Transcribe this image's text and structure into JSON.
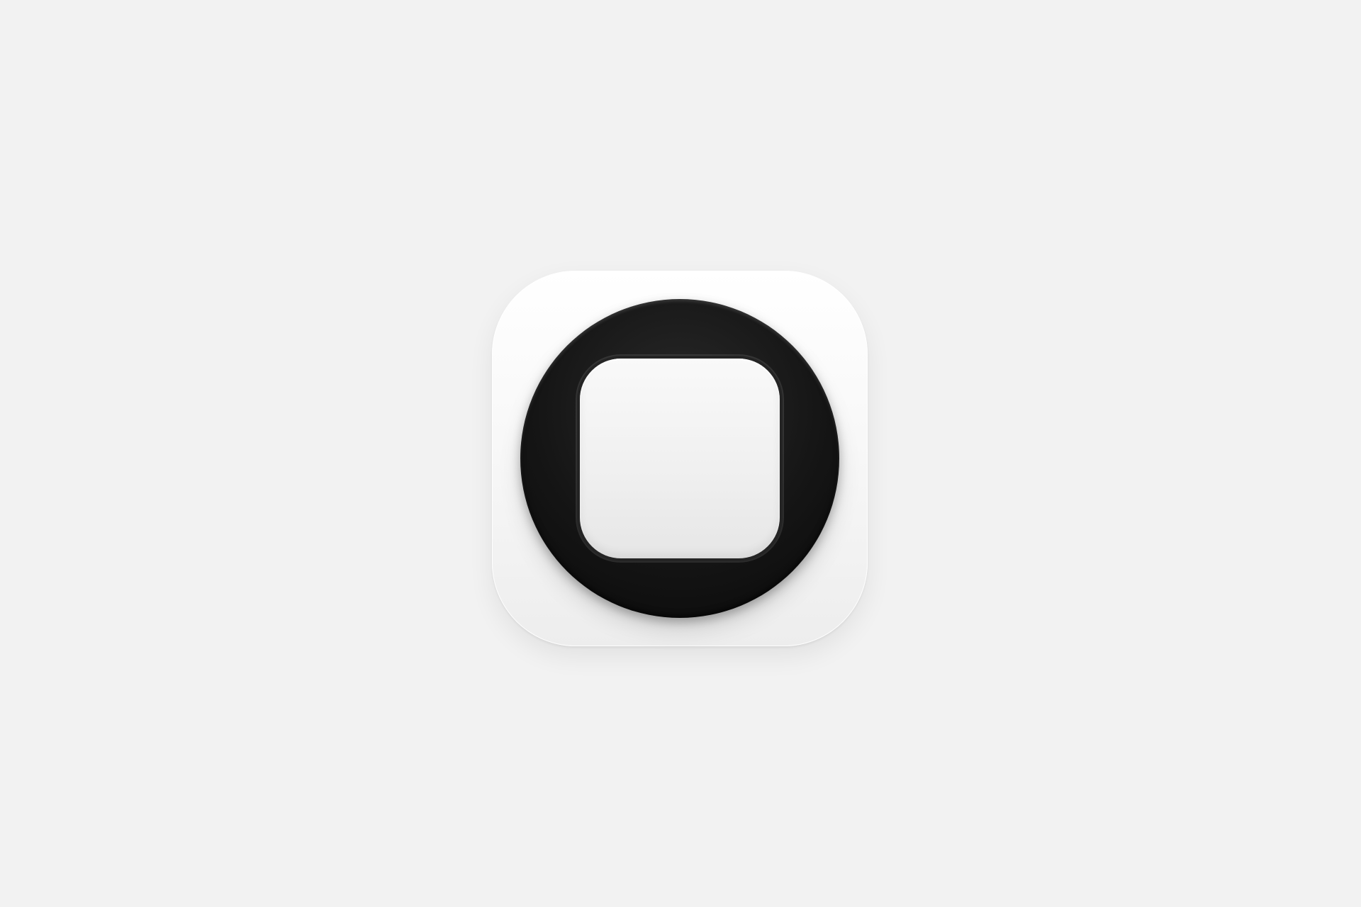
{
  "page": {
    "background_color": "#f2f2f2"
  },
  "app_icon": {
    "icon": "rounded-square-in-circle-icon",
    "tile_color": "#f7f7f7",
    "ring_color": "#111111",
    "inner_square_color": "#eeeeee"
  }
}
